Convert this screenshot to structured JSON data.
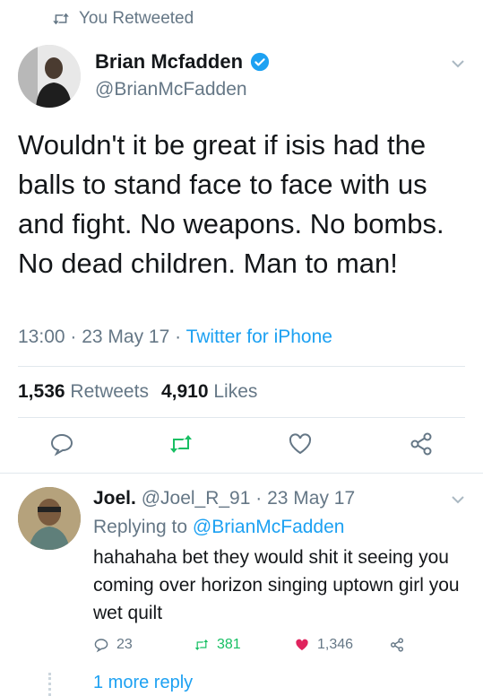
{
  "retweet_header": {
    "text": "You Retweeted"
  },
  "tweet": {
    "author_name": "Brian Mcfadden",
    "handle": "@BrianMcFadden",
    "text": "Wouldn't it be great if isis had the balls to stand face to face with us and fight. No weapons. No bombs. No dead children. Man to man!",
    "time": "13:00 · 23 May 17 · ",
    "source": "Twitter for iPhone",
    "retweets_count": "1,536",
    "retweets_label": "Retweets",
    "likes_count": "4,910",
    "likes_label": "Likes"
  },
  "reply": {
    "author_name": "Joel.",
    "handle_date": " @Joel_R_91 · 23 May 17",
    "replying_prefix": "Replying to ",
    "replying_to": "@BrianMcFadden",
    "text": "hahahaha bet they would shit it seeing you coming over horizon singing uptown girl you wet quilt",
    "replies_count": "23",
    "retweets_count": "381",
    "likes_count": "1,346",
    "more_reply": "1 more reply"
  },
  "colors": {
    "accent": "#1da1f2",
    "retweet_green": "#17bf63",
    "like_red": "#e0245e",
    "muted": "#657786"
  },
  "icons": {
    "retweet": "retweet-icon",
    "verified": "verified-badge-icon",
    "reply": "reply-icon",
    "like": "heart-icon",
    "share": "share-icon",
    "chevron": "chevron-down-icon"
  }
}
